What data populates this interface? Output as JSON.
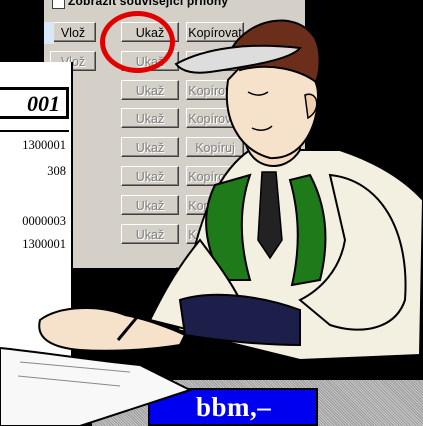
{
  "dialog": {
    "checkbox_label": "Zobrazit související přílohy",
    "rows": [
      {
        "insert": "Vlož",
        "show": "Ukaž",
        "copy": "Kopírovat",
        "insert_dim": false,
        "show_dim": false
      },
      {
        "insert": "Vlož",
        "show": "Ukaž",
        "copy": "Kopírovat",
        "insert_dim": true,
        "show_dim": true
      },
      {
        "show": "Ukaž",
        "copy": "Kopírovat",
        "dim": true
      },
      {
        "show": "Ukaž",
        "copy": "Kopírovat",
        "dim": true
      },
      {
        "show": "Ukaž",
        "copy": "Kopíruj",
        "dim": true
      },
      {
        "show": "Ukaž",
        "copy": "Kopírovat",
        "dim": true
      },
      {
        "show": "Ukaž",
        "copy": "Kopírovat",
        "dim": true
      },
      {
        "show": "Ukaž",
        "copy": "Kopírovat",
        "dim": true
      }
    ],
    "highlight_color": "#e00000"
  },
  "document": {
    "heading": "001",
    "numbers": [
      "1300001",
      "308",
      "0000003",
      "1300001"
    ]
  },
  "footer": {
    "label": "bbm,–",
    "bg_color": "#0000f0"
  },
  "illustration": {
    "subject": "man-writing-clipart-icon"
  }
}
